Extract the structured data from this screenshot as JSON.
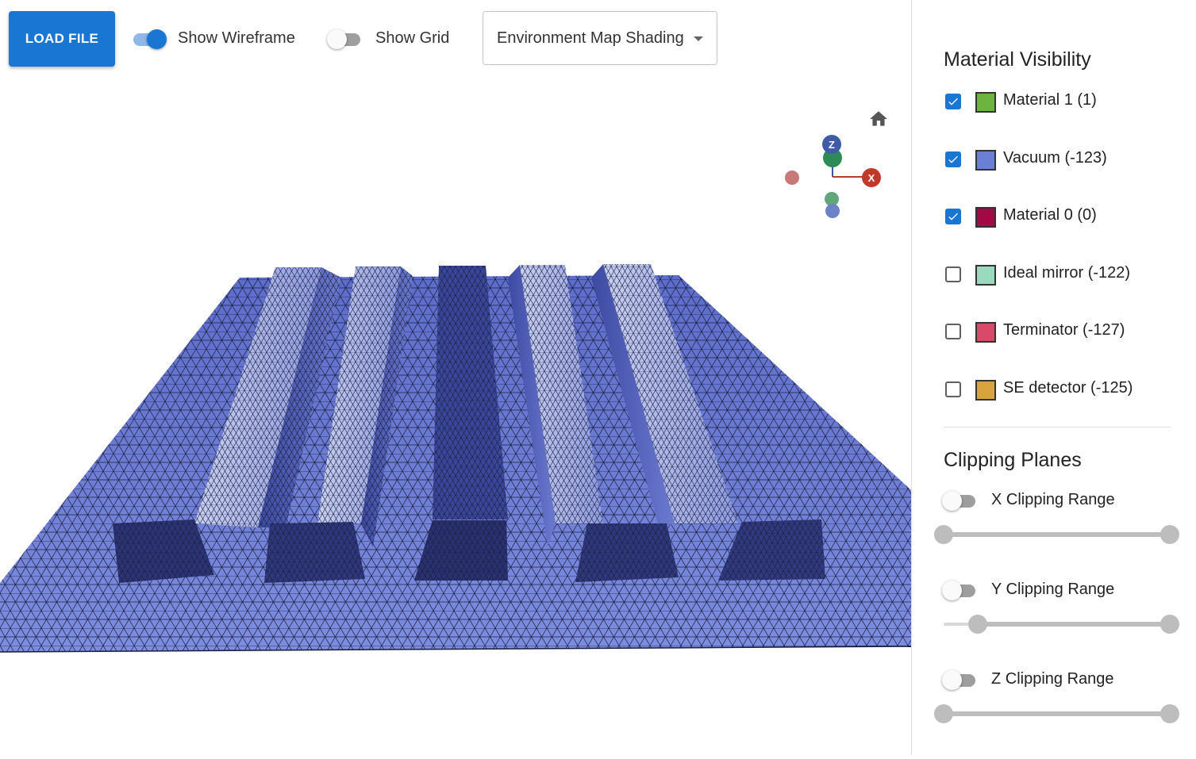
{
  "toolbar": {
    "load_label": "LOAD FILE",
    "wireframe": {
      "label": "Show Wireframe",
      "on": true
    },
    "grid": {
      "label": "Show Grid",
      "on": false
    },
    "shading_select": {
      "value": "Environment Map Shading"
    }
  },
  "viewport": {
    "axis_labels": {
      "z": "Z",
      "x": "X"
    },
    "axis_colors": {
      "x": "#c0392b",
      "y": "#2e8b57",
      "z": "#3f5aa8"
    },
    "mesh_color": "#6c7ed6"
  },
  "sidebar": {
    "materials_title": "Material Visibility",
    "materials": [
      {
        "label": "Material 1 (1)",
        "color": "#6db33f",
        "checked": true
      },
      {
        "label": "Vacuum (-123)",
        "color": "#6a7fd5",
        "checked": true
      },
      {
        "label": "Material 0 (0)",
        "color": "#a30a45",
        "checked": true
      },
      {
        "label": "Ideal mirror (-122)",
        "color": "#9adbbf",
        "checked": false
      },
      {
        "label": "Terminator (-127)",
        "color": "#d8496a",
        "checked": false
      },
      {
        "label": "SE detector (-125)",
        "color": "#d9a33f",
        "checked": false
      }
    ],
    "clipping_title": "Clipping Planes",
    "clipping": [
      {
        "label": "X Clipping Range",
        "enabled": false,
        "range": [
          0,
          1
        ]
      },
      {
        "label": "Y Clipping Range",
        "enabled": false,
        "range": [
          0.15,
          1
        ]
      },
      {
        "label": "Z Clipping Range",
        "enabled": false,
        "range": [
          0,
          1
        ]
      }
    ]
  }
}
